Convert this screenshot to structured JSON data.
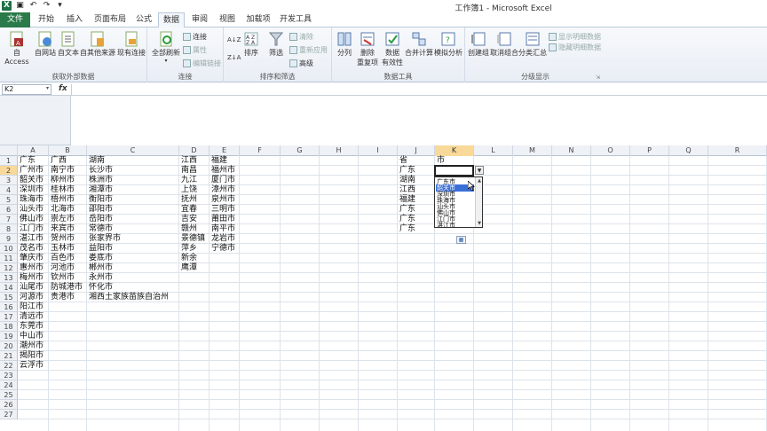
{
  "window": {
    "title": "工作簿1 - Microsoft Excel"
  },
  "tabs": [
    "文件",
    "开始",
    "插入",
    "页面布局",
    "公式",
    "数据",
    "审阅",
    "视图",
    "加载项",
    "开发工具"
  ],
  "ribbon": {
    "groups": {
      "external": "获取外部数据",
      "connections": "连接",
      "sort_filter": "排序和筛选",
      "data_tools": "数据工具",
      "outline": "分级显示"
    },
    "buttons": {
      "access": "自 Access",
      "web": "自网站",
      "text": "自文本",
      "other": "自其他来源",
      "existing": "现有连接",
      "refresh": "全部刷新",
      "connections": "连接",
      "properties": "属性",
      "edit_links": "编辑链接",
      "sort_az": "A↓Z",
      "sort_za": "Z↓A",
      "sort": "排序",
      "filter": "筛选",
      "clear": "清除",
      "reapply": "重新应用",
      "advanced": "高级",
      "split": "分列",
      "remove_dup_1": "删除",
      "remove_dup_2": "重复项",
      "validation_1": "数据",
      "validation_2": "有效性",
      "consolidate": "合并计算",
      "whatif": "模拟分析",
      "group": "创建组",
      "ungroup": "取消组合",
      "subtotal": "分类汇总",
      "show_detail": "显示明细数据",
      "hide_detail": "隐藏明细数据"
    }
  },
  "formula_bar": {
    "name_box": "K2",
    "fx": "fx",
    "content": ""
  },
  "sheet": {
    "columns": [
      "A",
      "B",
      "C",
      "D",
      "E",
      "F",
      "G",
      "H",
      "I",
      "J",
      "K",
      "L",
      "M",
      "N",
      "O",
      "P",
      "Q",
      "R"
    ],
    "rows": [
      "1",
      "2",
      "3",
      "4",
      "5",
      "6",
      "7",
      "8",
      "9",
      "10",
      "11",
      "12",
      "13",
      "14",
      "15",
      "16",
      "17",
      "18",
      "19",
      "20",
      "21",
      "22",
      "23",
      "24",
      "25",
      "26",
      "27"
    ],
    "selected": "K2",
    "colA": [
      "广东",
      "广州市",
      "韶关市",
      "深圳市",
      "珠海市",
      "汕头市",
      "佛山市",
      "江门市",
      "湛江市",
      "茂名市",
      "肇庆市",
      "惠州市",
      "梅州市",
      "汕尾市",
      "河源市",
      "阳江市",
      "清远市",
      "东莞市",
      "中山市",
      "潮州市",
      "揭阳市",
      "云浮市"
    ],
    "colB": [
      "广西",
      "南宁市",
      "柳州市",
      "桂林市",
      "梧州市",
      "北海市",
      "崇左市",
      "来宾市",
      "贺州市",
      "玉林市",
      "百色市",
      "河池市",
      "钦州市",
      "防城港市",
      "贵港市"
    ],
    "colC": [
      "湖南",
      "长沙市",
      "株洲市",
      "湘潭市",
      "衡阳市",
      "邵阳市",
      "岳阳市",
      "常德市",
      "张家界市",
      "益阳市",
      "娄底市",
      "郴州市",
      "永州市",
      "怀化市",
      "湘西土家族苗族自治州"
    ],
    "colD": [
      "江西",
      "南昌",
      "九江",
      "上饶",
      "抚州",
      "宜春",
      "吉安",
      "赣州",
      "景德镇",
      "萍乡",
      "新余",
      "鹰潭"
    ],
    "colE": [
      "福建",
      "福州市",
      "厦门市",
      "漳州市",
      "泉州市",
      "三明市",
      "莆田市",
      "南平市",
      "龙岩市",
      "宁德市"
    ],
    "colJ": [
      "省",
      "广东",
      "湖南",
      "江西",
      "福建",
      "广东",
      "广东",
      "广东"
    ],
    "colK1": "市"
  },
  "dropdown": {
    "items": [
      "广东市",
      "韶关市",
      "深圳市",
      "珠海市",
      "汕头市",
      "佛山市",
      "江门市",
      "湛江市"
    ],
    "highlighted": 1
  }
}
